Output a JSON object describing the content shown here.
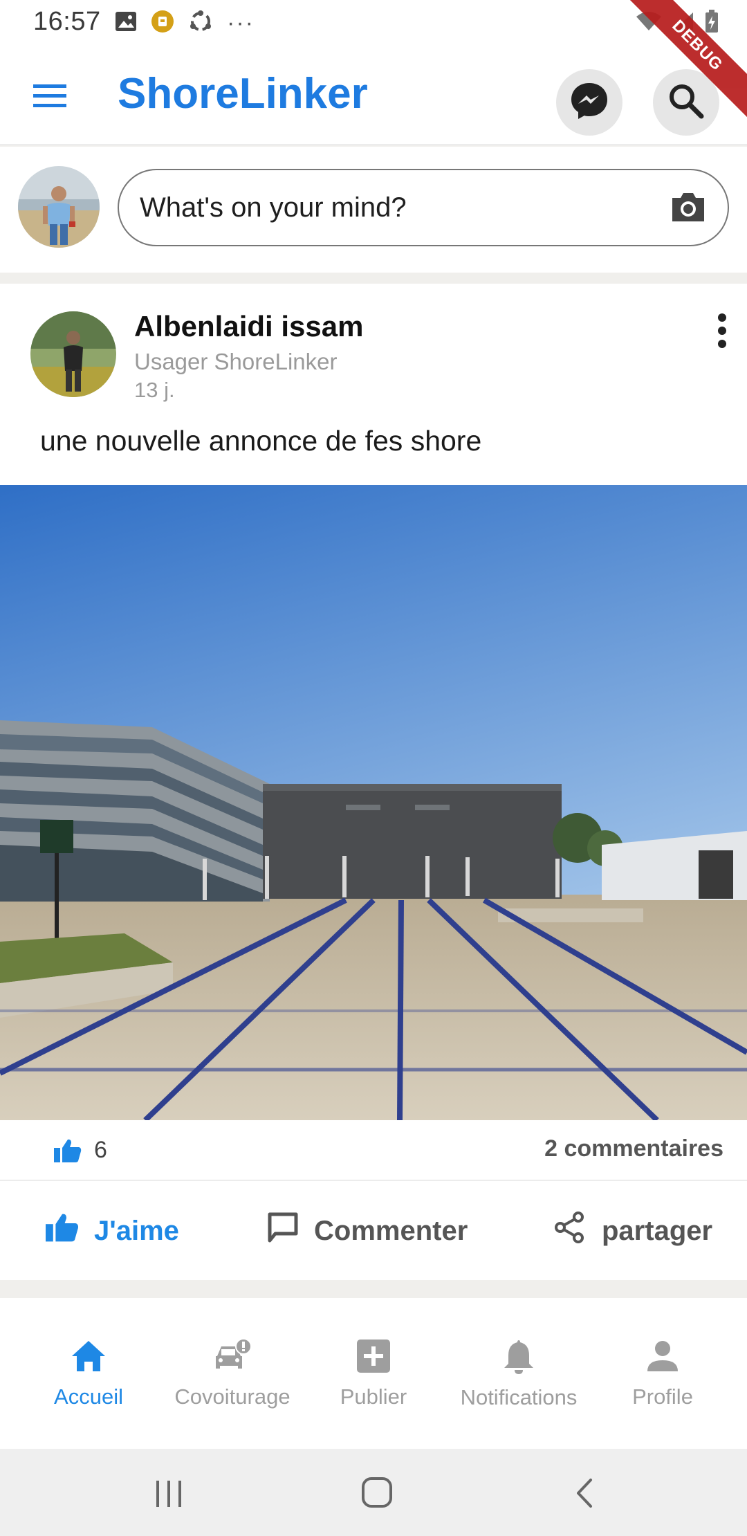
{
  "status_bar": {
    "time": "16:57",
    "left_icons": [
      "image-icon",
      "notification-badge-icon",
      "sync-icon",
      "more-dots-icon"
    ],
    "right_icons": [
      "wifi-icon",
      "signal-icon",
      "battery-charging-icon"
    ],
    "debug_label": "DEBUG"
  },
  "app_bar": {
    "title": "ShoreLinker",
    "menu_icon": "menu-icon",
    "messenger_icon": "messenger-icon",
    "search_icon": "search-icon"
  },
  "composer": {
    "placeholder": "What's on your mind?",
    "camera_icon": "camera-icon"
  },
  "post": {
    "author": "Albenlaidi issam",
    "subtitle": "Usager ShoreLinker",
    "time": "13 j.",
    "text": "une nouvelle annonce de fes shore",
    "likes": "6",
    "comments": "2 commentaires",
    "actions": {
      "like": "J'aime",
      "comment": "Commenter",
      "share": "partager"
    }
  },
  "bottom_nav": {
    "items": [
      {
        "label": "Accueil",
        "icon": "home-icon",
        "active": true
      },
      {
        "label": "Covoiturage",
        "icon": "car-alert-icon",
        "active": false
      },
      {
        "label": "Publier",
        "icon": "add-box-icon",
        "active": false
      },
      {
        "label": "Notifications",
        "icon": "bell-icon",
        "active": false
      },
      {
        "label": "Profile",
        "icon": "person-icon",
        "active": false
      }
    ]
  },
  "colors": {
    "accent": "#1e88e5",
    "title_blue": "#1e7be0",
    "inactive": "#9e9e9e"
  }
}
